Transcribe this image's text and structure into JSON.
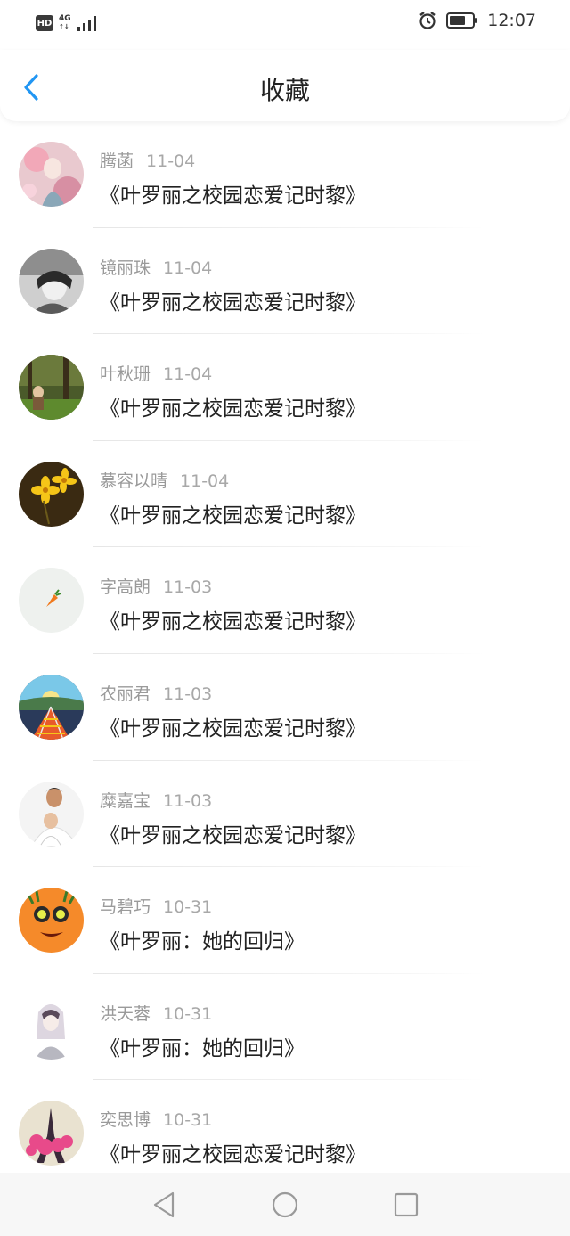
{
  "status_bar": {
    "hd": "HD",
    "net": "4G",
    "time": "12:07"
  },
  "header": {
    "title": "收藏"
  },
  "favorites": [
    {
      "user": "腾菡",
      "date": "11-04",
      "book": "《叶罗丽之校园恋爱记时黎》",
      "avatar": "pink-girl-avatar"
    },
    {
      "user": "镜丽珠",
      "date": "11-04",
      "book": "《叶罗丽之校园恋爱记时黎》",
      "avatar": "bw-girl-avatar"
    },
    {
      "user": "叶秋珊",
      "date": "11-04",
      "book": "《叶罗丽之校园恋爱记时黎》",
      "avatar": "forest-child-avatar"
    },
    {
      "user": "慕容以晴",
      "date": "11-04",
      "book": "《叶罗丽之校园恋爱记时黎》",
      "avatar": "yellow-flower-avatar"
    },
    {
      "user": "字高朗",
      "date": "11-03",
      "book": "《叶罗丽之校园恋爱记时黎》",
      "avatar": "carrot-avatar"
    },
    {
      "user": "农丽君",
      "date": "11-03",
      "book": "《叶罗丽之校园恋爱记时黎》",
      "avatar": "railway-avatar"
    },
    {
      "user": "糜嘉宝",
      "date": "11-03",
      "book": "《叶罗丽之校园恋爱记时黎》",
      "avatar": "father-child-avatar"
    },
    {
      "user": "马碧巧",
      "date": "10-31",
      "book": "《叶罗丽：她的回归》",
      "avatar": "orange-monster-avatar"
    },
    {
      "user": "洪天蓉",
      "date": "10-31",
      "book": "《叶罗丽：她的回归》",
      "avatar": "sketch-girl-avatar"
    },
    {
      "user": "奕思博",
      "date": "10-31",
      "book": "《叶罗丽之校园恋爱记时黎》",
      "avatar": "eiffel-tower-avatar"
    }
  ],
  "colors": {
    "accent": "#2196F3",
    "meta_text": "#9a9a9a",
    "title_text": "#222222"
  }
}
